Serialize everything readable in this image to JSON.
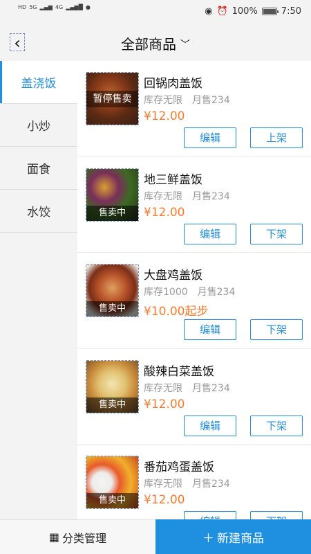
{
  "status": {
    "battery": "100%",
    "time": "7:50",
    "network": "4G",
    "left_icons": [
      "HD",
      "5G",
      "4G"
    ]
  },
  "header": {
    "title": "全部商品",
    "back_icon": "chevron-left-icon",
    "dropdown_icon": "chevron-down-icon"
  },
  "sidebar": {
    "items": [
      {
        "label": "盖浇饭",
        "active": true
      },
      {
        "label": "小炒",
        "active": false
      },
      {
        "label": "面食",
        "active": false
      },
      {
        "label": "水饺",
        "active": false
      }
    ]
  },
  "products": [
    {
      "name": "回锅肉盖饭",
      "stock": "库存无限",
      "sales": "月售234",
      "price": "¥12.00",
      "status": "暂停售卖",
      "edit_label": "编辑",
      "toggle_label": "上架"
    },
    {
      "name": "地三鲜盖饭",
      "stock": "库存无限",
      "sales": "月售234",
      "price": "¥12.00",
      "status": "售卖中",
      "edit_label": "编辑",
      "toggle_label": "下架"
    },
    {
      "name": "大盘鸡盖饭",
      "stock": "库存1000",
      "sales": "月售234",
      "price": "¥10.00起步",
      "status": "售卖中",
      "edit_label": "编辑",
      "toggle_label": "下架"
    },
    {
      "name": "酸辣白菜盖饭",
      "stock": "库存无限",
      "sales": "月售234",
      "price": "¥12.00",
      "status": "售卖中",
      "edit_label": "编辑",
      "toggle_label": "下架"
    },
    {
      "name": "番茄鸡蛋盖饭",
      "stock": "库存无限",
      "sales": "月售234",
      "price": "¥12.00",
      "status": "售卖中",
      "edit_label": "编辑",
      "toggle_label": "下架"
    }
  ],
  "bottom": {
    "category_label": "分类管理",
    "new_label": "新建商品"
  },
  "colors": {
    "accent": "#1f8fe0",
    "price": "#ff7a2a"
  }
}
